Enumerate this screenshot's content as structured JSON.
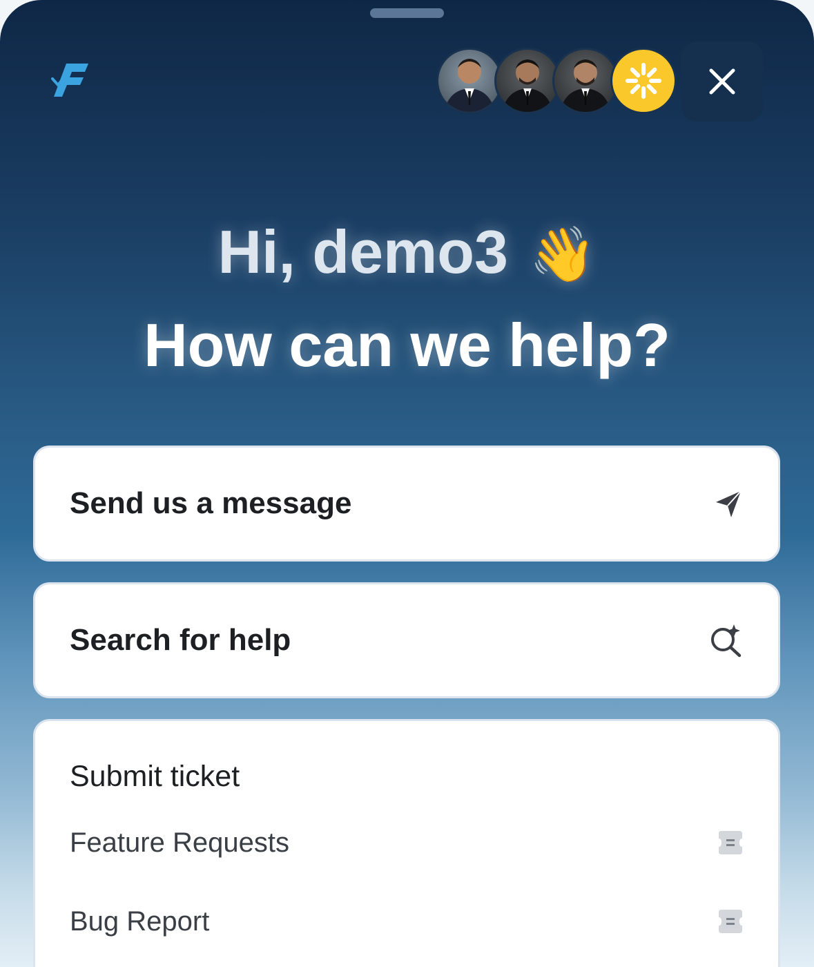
{
  "greeting": {
    "line1": "Hi, demo3",
    "wave_emoji": "👋",
    "line2": "How can we help?"
  },
  "header": {
    "logo_icon": "brand-f-logo-icon",
    "avatars": [
      "team-member-1",
      "team-member-2",
      "team-member-3",
      "brand-sunburst"
    ],
    "close_icon": "close-icon"
  },
  "actions": [
    {
      "label": "Send us a message",
      "icon": "send-icon"
    },
    {
      "label": "Search for help",
      "icon": "search-sparkle-icon"
    }
  ],
  "tickets": {
    "title": "Submit ticket",
    "items": [
      {
        "label": "Feature Requests",
        "icon": "ticket-icon"
      },
      {
        "label": "Bug Report",
        "icon": "ticket-icon"
      }
    ]
  },
  "colors": {
    "gradient_top": "#0f2746",
    "gradient_mid": "#2e6a97",
    "gradient_bottom": "#e3eef6",
    "brand_yellow": "#fbc82c",
    "logo_blue": "#3ba4e0"
  }
}
